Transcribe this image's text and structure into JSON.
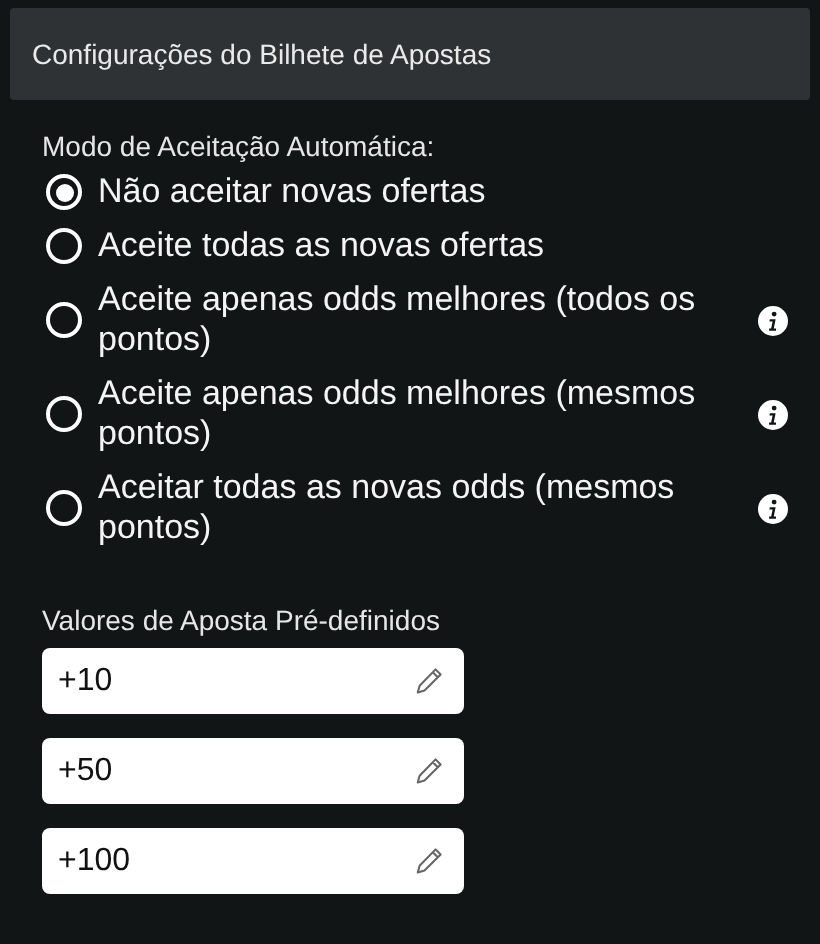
{
  "header": {
    "title": "Configurações do Bilhete de Apostas"
  },
  "acceptance": {
    "label": "Modo de Aceitação Automática:",
    "options": [
      {
        "label": "Não aceitar novas ofertas",
        "selected": true,
        "info": false
      },
      {
        "label": "Aceite todas as novas ofertas",
        "selected": false,
        "info": false
      },
      {
        "label": "Aceite apenas odds melhores (todos os pontos)",
        "selected": false,
        "info": true
      },
      {
        "label": "Aceite apenas odds melhores (mesmos pontos)",
        "selected": false,
        "info": true
      },
      {
        "label": "Aceitar todas as novas odds (mesmos pontos)",
        "selected": false,
        "info": true
      }
    ]
  },
  "stakes": {
    "label": "Valores de Aposta Pré-definidos",
    "values": [
      "+10",
      "+50",
      "+100"
    ]
  }
}
